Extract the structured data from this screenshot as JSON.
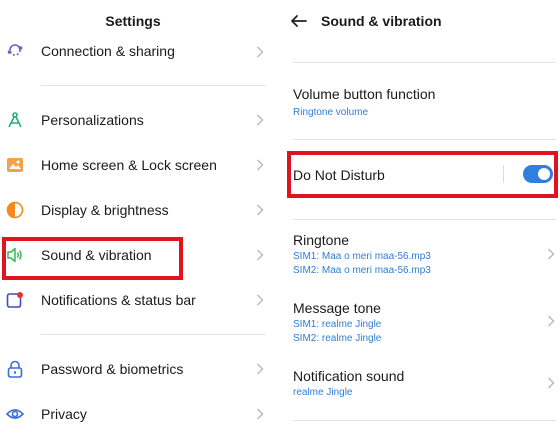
{
  "left": {
    "title": "Settings",
    "items": [
      {
        "label": "Connection & sharing",
        "icon": "connection-icon"
      },
      {
        "label": "Personalizations",
        "icon": "personalizations-icon"
      },
      {
        "label": "Home screen & Lock screen",
        "icon": "home-screen-icon"
      },
      {
        "label": "Display & brightness",
        "icon": "display-brightness-icon"
      },
      {
        "label": "Sound & vibration",
        "icon": "speaker-icon"
      },
      {
        "label": "Notifications & status bar",
        "icon": "notifications-icon"
      },
      {
        "label": "Password & biometrics",
        "icon": "lock-icon"
      },
      {
        "label": "Privacy",
        "icon": "privacy-eye-icon"
      }
    ]
  },
  "right": {
    "title": "Sound & vibration",
    "volume_button": {
      "title": "Volume button function",
      "subtitle": "Ringtone volume"
    },
    "dnd": {
      "title": "Do Not Disturb",
      "enabled": true
    },
    "ringtone": {
      "title": "Ringtone",
      "sim1": "SIM1: Maa o meri maa-56.mp3",
      "sim2": "SIM2: Maa o meri maa-56.mp3"
    },
    "message_tone": {
      "title": "Message tone",
      "sim1": "SIM1: realme Jingle",
      "sim2": "SIM2: realme Jingle"
    },
    "notification_sound": {
      "title": "Notification sound",
      "subtitle": "realme Jingle"
    }
  },
  "colors": {
    "highlight": "#e0141e",
    "accent": "#2d7fd6",
    "toggle_on": "#2f7fe0"
  }
}
